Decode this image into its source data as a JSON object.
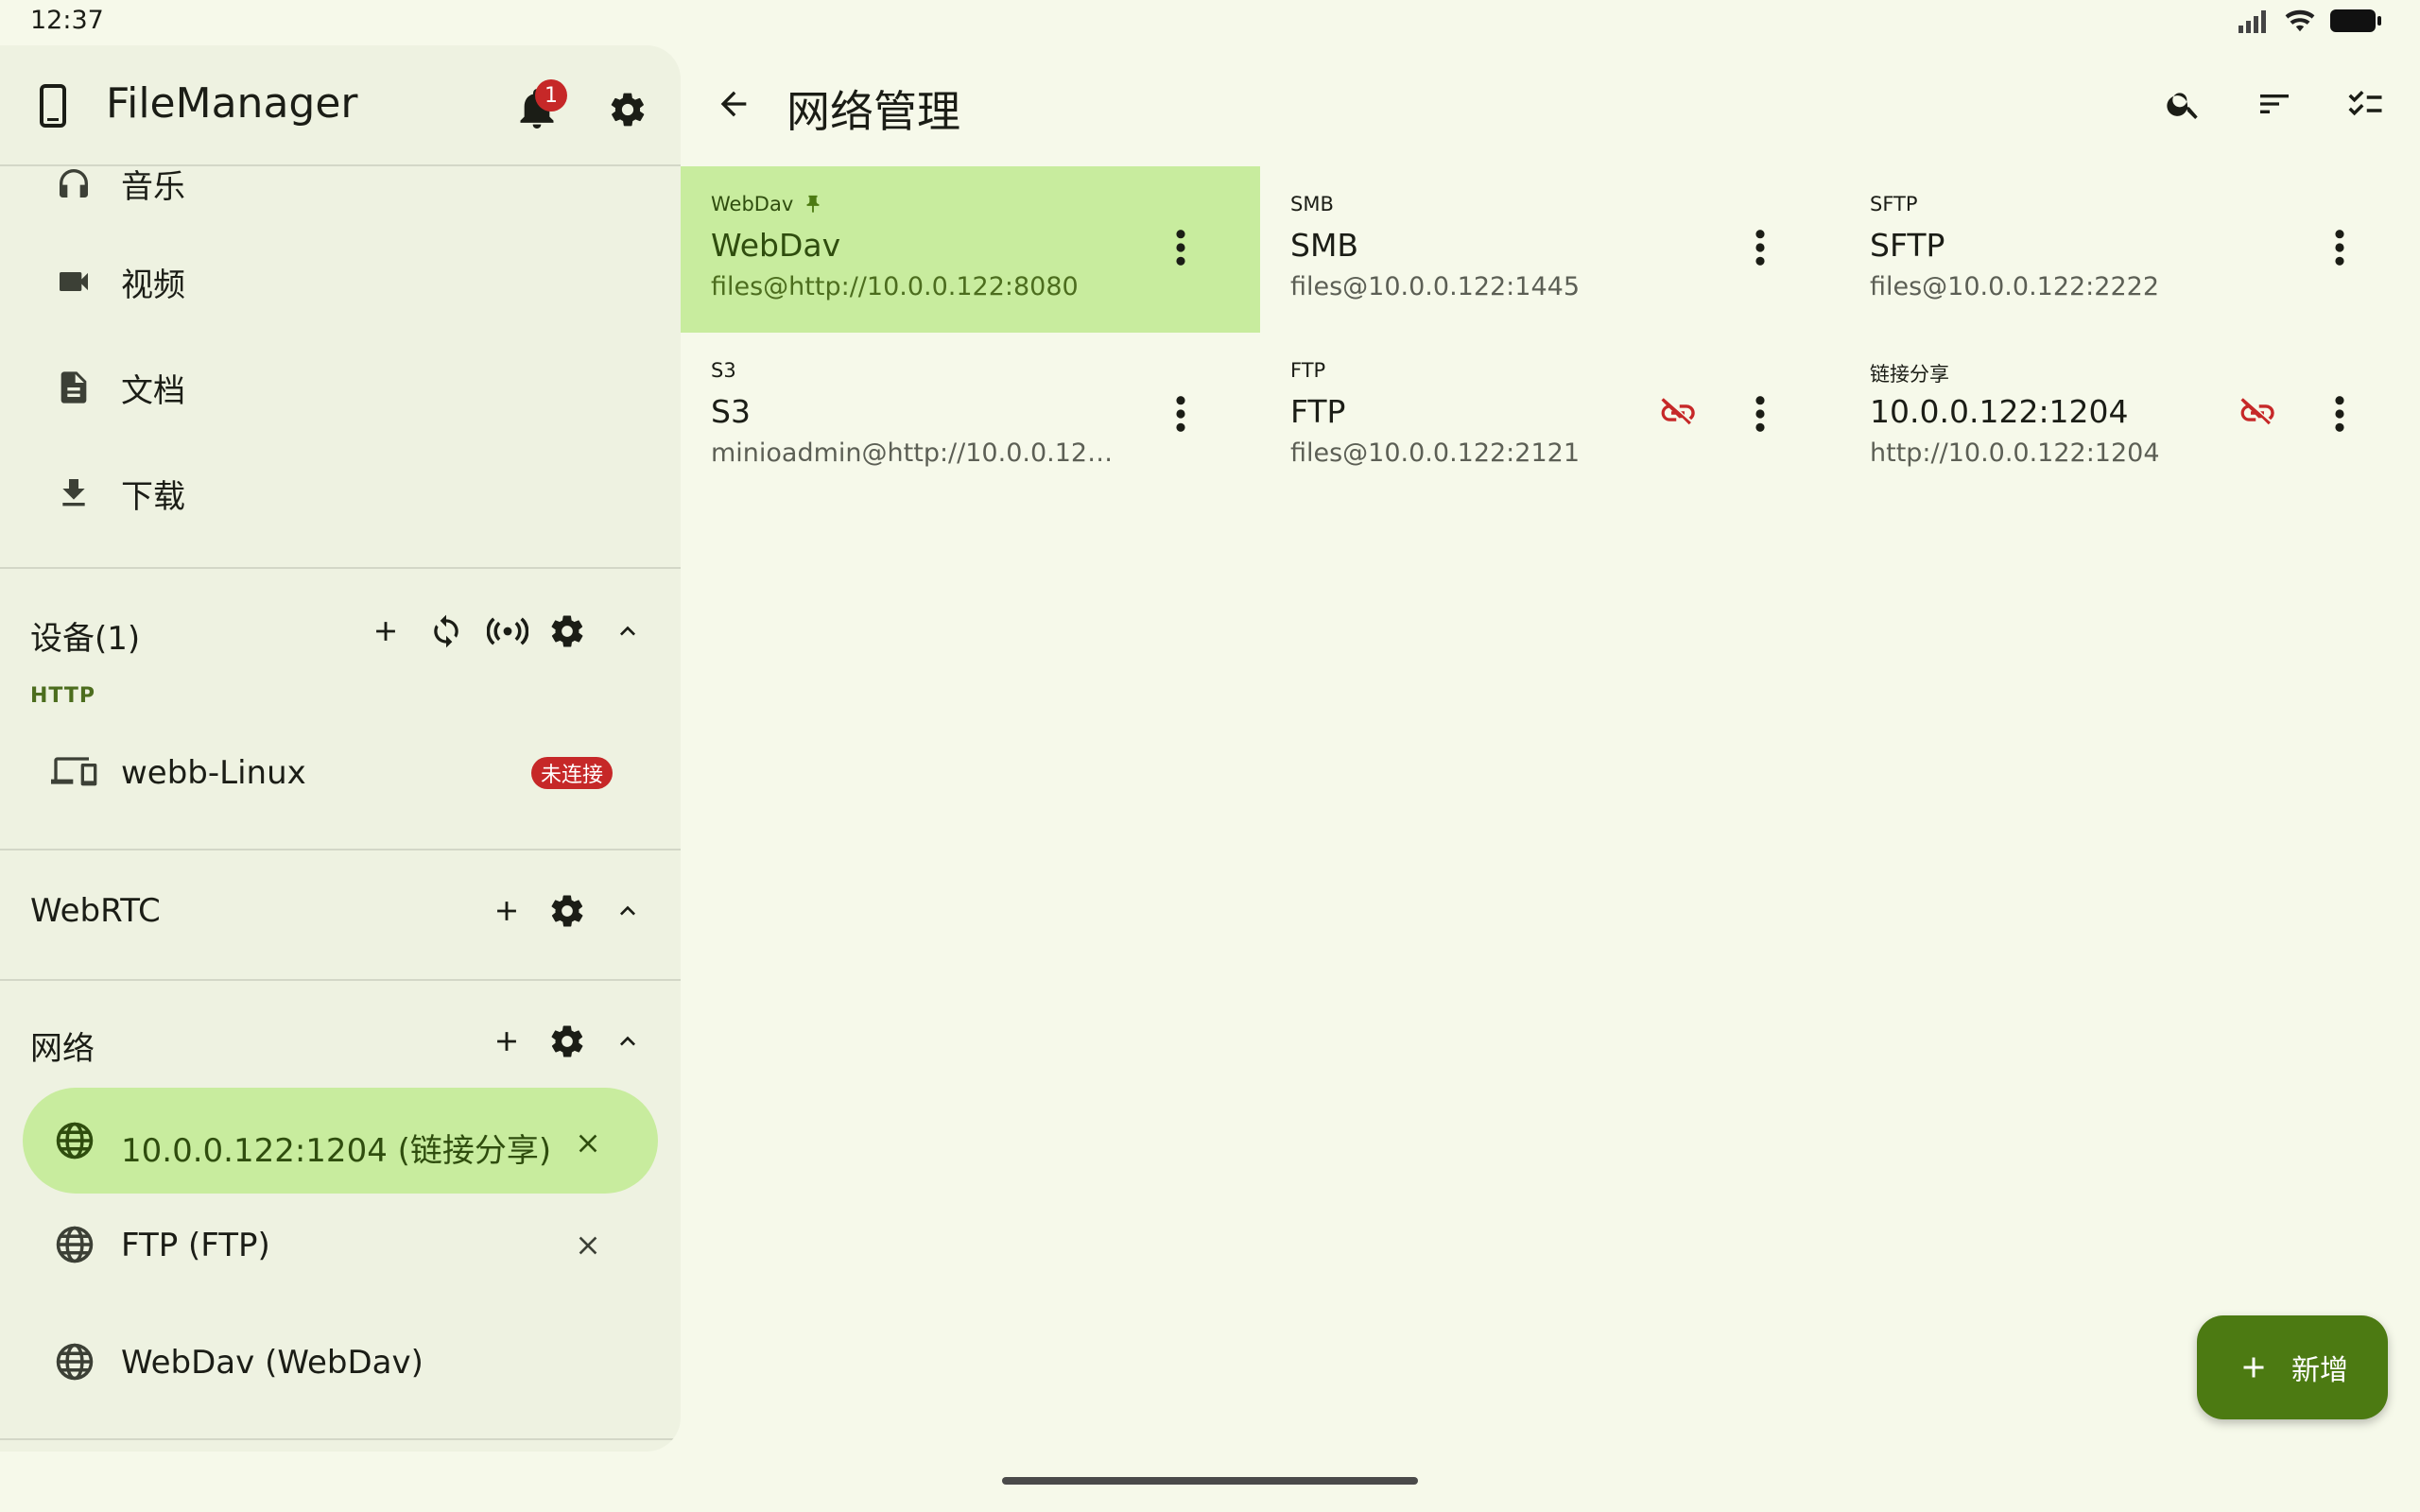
{
  "status": {
    "time": "12:37"
  },
  "sidebar": {
    "app_title": "FileManager",
    "notification_count": "1",
    "nav_items": [
      {
        "label": "音乐",
        "icon": "headphones-icon"
      },
      {
        "label": "视频",
        "icon": "videocam-icon"
      },
      {
        "label": "文档",
        "icon": "document-icon"
      },
      {
        "label": "下载",
        "icon": "download-icon"
      }
    ],
    "devices": {
      "title": "设备(1)",
      "subtitle": "HTTP",
      "items": [
        {
          "label": "webb-Linux",
          "status": "未连接"
        }
      ]
    },
    "webrtc": {
      "title": "WebRTC"
    },
    "network": {
      "title": "网络",
      "items": [
        {
          "label": "10.0.0.122:1204 (链接分享)",
          "selected": true,
          "closable": true
        },
        {
          "label": "FTP (FTP)",
          "selected": false,
          "closable": true
        },
        {
          "label": "WebDav (WebDav)",
          "selected": false,
          "closable": false
        }
      ]
    }
  },
  "main": {
    "title": "网络管理",
    "connections": [
      {
        "protocol": "WebDav",
        "name": "WebDav",
        "address": "files@http://10.0.0.122:8080",
        "pinned": true,
        "selected": true,
        "disconnected": false
      },
      {
        "protocol": "SMB",
        "name": "SMB",
        "address": "files@10.0.0.122:1445",
        "pinned": false,
        "selected": false,
        "disconnected": false
      },
      {
        "protocol": "SFTP",
        "name": "SFTP",
        "address": "files@10.0.0.122:2222",
        "pinned": false,
        "selected": false,
        "disconnected": false
      },
      {
        "protocol": "S3",
        "name": "S3",
        "address": "minioadmin@http://10.0.0.122:...",
        "pinned": false,
        "selected": false,
        "disconnected": false
      },
      {
        "protocol": "FTP",
        "name": "FTP",
        "address": "files@10.0.0.122:2121",
        "pinned": false,
        "selected": false,
        "disconnected": true
      },
      {
        "protocol": "链接分享",
        "name": "10.0.0.122:1204",
        "address": "http://10.0.0.122:1204",
        "pinned": false,
        "selected": false,
        "disconnected": true
      }
    ],
    "fab_label": "新增"
  },
  "colors": {
    "background": "#f6f9ea",
    "sidebar": "#eef2e1",
    "selected": "#c8ec9e",
    "accent": "#4c7a12",
    "error": "#c62828"
  }
}
